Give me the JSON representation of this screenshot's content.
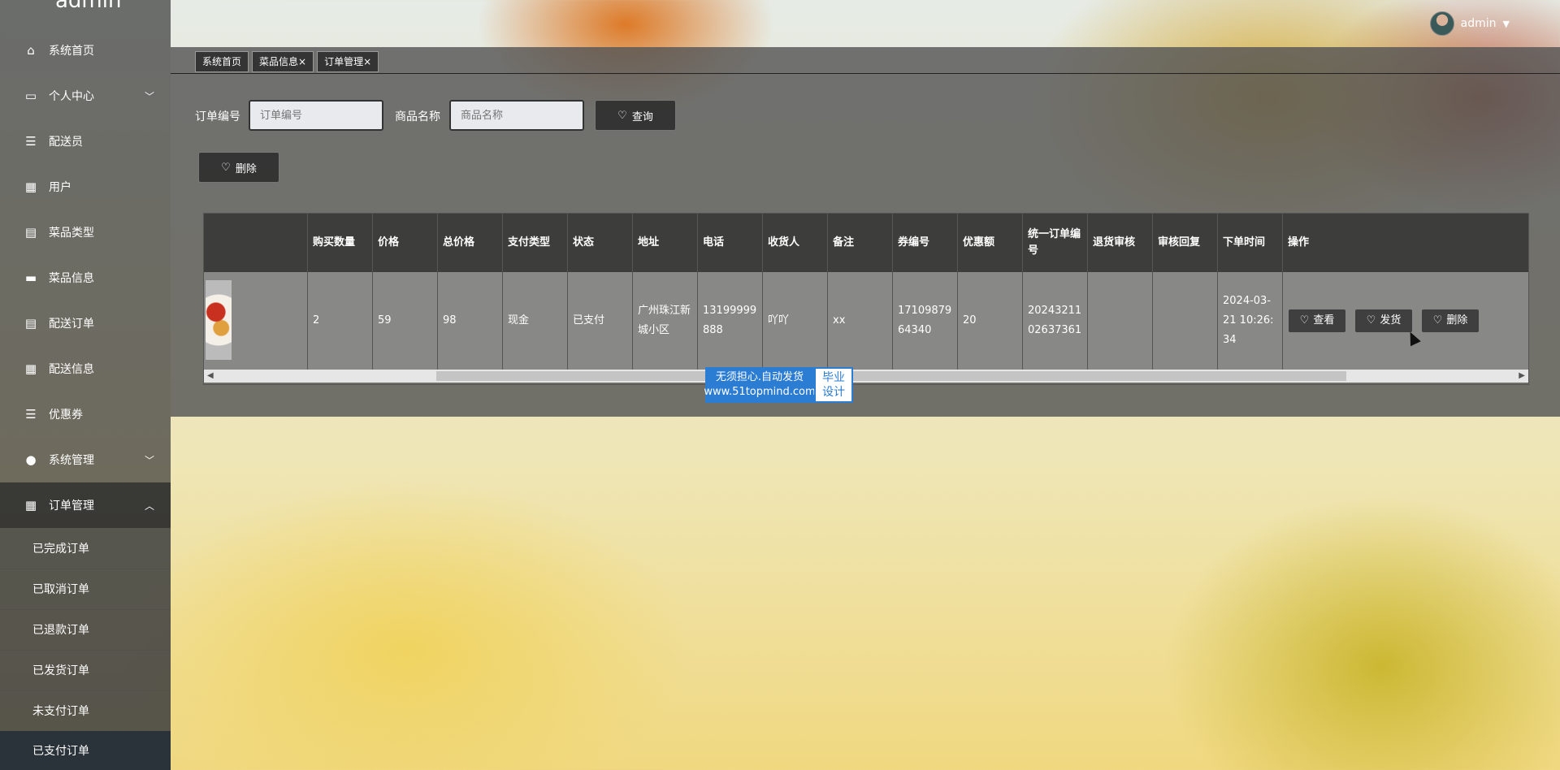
{
  "app": {
    "brand": "admin"
  },
  "user": {
    "name": "admin"
  },
  "sidebar": {
    "items": [
      {
        "label": "系统首页",
        "icon": "home-icon"
      },
      {
        "label": "个人中心",
        "icon": "card-icon"
      },
      {
        "label": "配送员",
        "icon": "list-icon"
      },
      {
        "label": "用户",
        "icon": "grid-icon"
      },
      {
        "label": "菜品类型",
        "icon": "clipboard-icon"
      },
      {
        "label": "菜品信息",
        "icon": "briefcase-icon"
      },
      {
        "label": "配送订单",
        "icon": "clipboard-icon"
      },
      {
        "label": "配送信息",
        "icon": "grid-icon"
      },
      {
        "label": "优惠券",
        "icon": "list-icon"
      },
      {
        "label": "系统管理",
        "icon": "person-icon"
      },
      {
        "label": "订单管理",
        "icon": "grid-icon"
      }
    ],
    "sub_items": [
      {
        "label": "已完成订单"
      },
      {
        "label": "已取消订单"
      },
      {
        "label": "已退款订单"
      },
      {
        "label": "已发货订单"
      },
      {
        "label": "未支付订单"
      },
      {
        "label": "已支付订单"
      }
    ]
  },
  "tabs": [
    {
      "label": "系统首页"
    },
    {
      "label": "菜品信息×"
    },
    {
      "label": "订单管理×"
    }
  ],
  "search": {
    "order_no_label": "订单编号",
    "order_no_placeholder": "订单编号",
    "dish_name_label": "商品名称",
    "dish_name_placeholder": "商品名称",
    "query_button": "查询",
    "delete_button": "删除"
  },
  "table": {
    "headers": [
      "购买数量",
      "价格",
      "总价格",
      "支付类型",
      "状态",
      "地址",
      "电话",
      "收货人",
      "备注",
      "券编号",
      "优惠额",
      "统一订单编号",
      "退货审核",
      "审核回复",
      "下单时间",
      "操作"
    ],
    "rows": [
      {
        "quantity": "2",
        "price": "59",
        "total": "98",
        "pay_type": "现金",
        "status": "已支付",
        "address": "广州珠江新城小区",
        "phone": "13199999888",
        "receiver": "吖吖",
        "remark": "xx",
        "coupon_no": "1710987964340",
        "discount": "20",
        "unified_order_no": "2024321102637361",
        "return_review": "",
        "review_reply": "",
        "order_time": "2024-03-21 10:26:34",
        "actions": {
          "view": "查看",
          "ship": "发货",
          "delete": "删除"
        }
      }
    ]
  },
  "watermark": {
    "line1": "无须担心.自动发货",
    "line2": "www.51topmind.com",
    "side1": "毕业",
    "side2": "设计"
  },
  "colors": {
    "watermark_blue": "#2b7cd3"
  }
}
